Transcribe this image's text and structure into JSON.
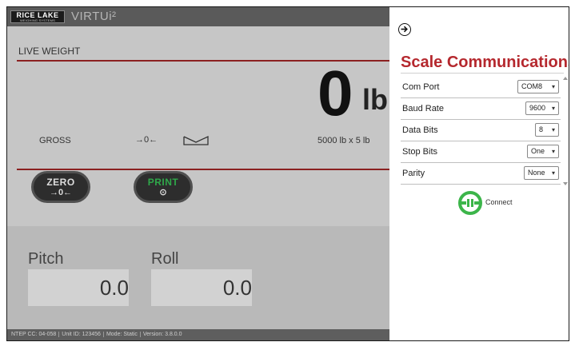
{
  "header": {
    "logo_text": "RICE LAKE",
    "logo_subtext": "WEIGHING SYSTEMS",
    "product_name": "VIRTUi²"
  },
  "weight": {
    "section_label": "LIVE WEIGHT",
    "value": "0",
    "unit": "lb",
    "mode": "GROSS",
    "center_zero_symbol": "→0←",
    "capacity": "5000 lb x 5 lb"
  },
  "buttons": {
    "zero_label": "ZERO",
    "zero_sub": "→0←",
    "print_label": "PRINT",
    "print_sub": "⊙"
  },
  "tilt": {
    "pitch_label": "Pitch",
    "pitch_value": "0.0",
    "roll_label": "Roll",
    "roll_value": "0.0"
  },
  "status": {
    "ntep": "NTEP CC: 04-058",
    "unit_id": "Unit ID: 123456",
    "mode": "Mode: Static",
    "version": "Version: 3.8.0.0"
  },
  "panel": {
    "title": "Scale Communications",
    "settings": [
      {
        "label": "Com Port",
        "value": "COM8"
      },
      {
        "label": "Baud Rate",
        "value": "9600"
      },
      {
        "label": "Data Bits",
        "value": "8"
      },
      {
        "label": "Stop Bits",
        "value": "One"
      },
      {
        "label": "Parity",
        "value": "None"
      }
    ],
    "connect_label": "Connect"
  },
  "colors": {
    "title_red": "#b5282e",
    "connect_green": "#3cb54a",
    "print_green": "#2fa84a"
  },
  "icons": {
    "back": "arrow-right-circle-icon",
    "motion": "motion-indicator-icon",
    "connect": "connect-plug-icon"
  }
}
